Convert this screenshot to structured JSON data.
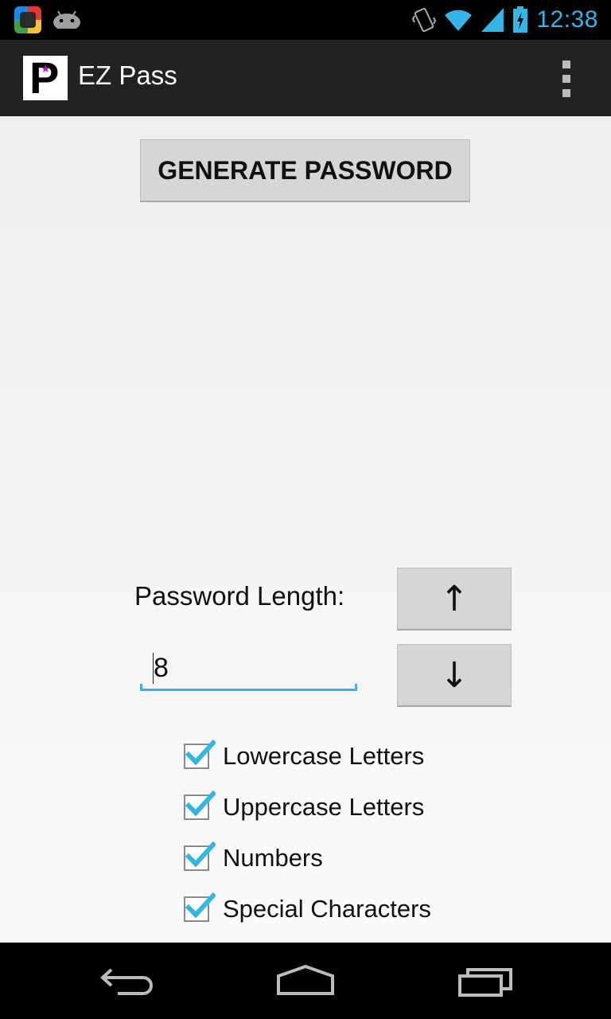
{
  "status_bar": {
    "time": "12:38",
    "icons": [
      "phone-app-notification-icon",
      "android-notification-icon",
      "vibrate-icon",
      "wifi-icon",
      "signal-icon",
      "battery-charging-icon"
    ]
  },
  "action_bar": {
    "app_icon_letter": "P",
    "title": "EZ Pass",
    "menu_icon": "overflow-menu-icon"
  },
  "main": {
    "generate_label": "GENERATE PASSWORD",
    "length_label": "Password Length:",
    "length_value": "8",
    "increase_label": "↑",
    "decrease_label": "↓",
    "options": [
      {
        "label": "Lowercase Letters",
        "checked": true
      },
      {
        "label": "Uppercase Letters",
        "checked": true
      },
      {
        "label": "Numbers",
        "checked": true
      },
      {
        "label": "Special Characters",
        "checked": true
      }
    ]
  },
  "nav_bar": {
    "buttons": [
      "back-icon",
      "home-icon",
      "recents-icon"
    ]
  },
  "colors": {
    "accent": "#33b5e5",
    "action_bar": "#222222",
    "button": "#d6d6d6"
  }
}
